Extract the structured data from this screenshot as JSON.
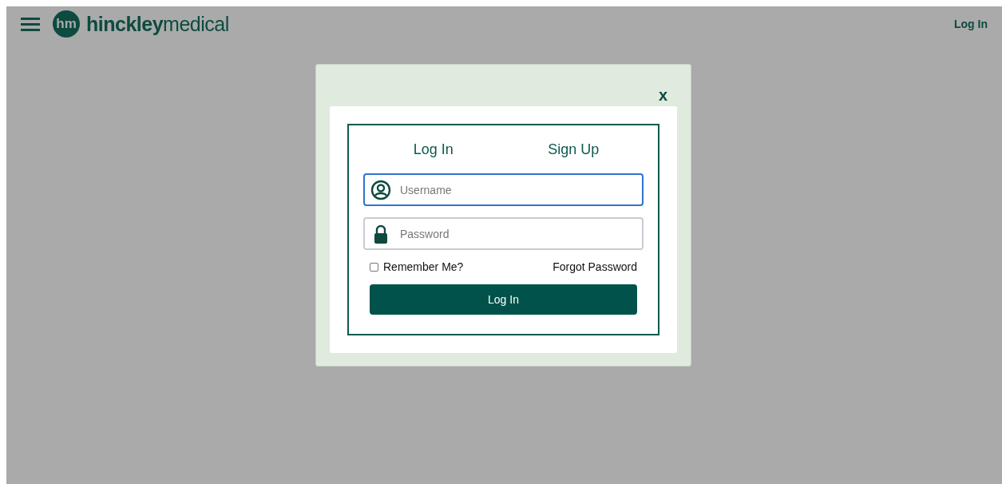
{
  "header": {
    "logo_mark": "hm",
    "logo_text": "**hinckley**medical",
    "login_link": "Log In"
  },
  "modal": {
    "close": "x",
    "tabs": [
      {
        "label": "Log In"
      },
      {
        "label": "Sign Up"
      }
    ],
    "fields": [
      {
        "kind": "user",
        "placeholder": "Username",
        "focused": true
      },
      {
        "kind": "lock",
        "placeholder": "Password",
        "focused": false
      }
    ],
    "remember": {
      "label": "Remember Me?",
      "checked": false
    },
    "forgot": "Forgot Password",
    "submit": "Log In"
  }
}
